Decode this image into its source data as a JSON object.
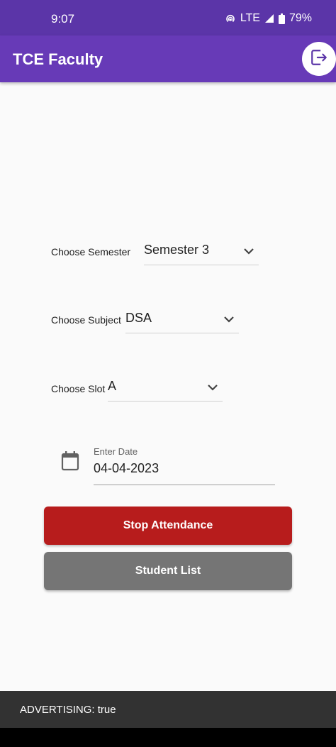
{
  "status_bar": {
    "time": "9:07",
    "network": "LTE",
    "battery": "79%"
  },
  "app_bar": {
    "title": "TCE Faculty",
    "logout_icon": "logout-icon",
    "accent": "#673ab7"
  },
  "form": {
    "semester": {
      "label": "Choose Semester",
      "value": "Semester 3"
    },
    "subject": {
      "label": "Choose Subject",
      "value": "DSA"
    },
    "slot": {
      "label": "Choose Slot",
      "value": "A"
    },
    "date": {
      "label": "Enter Date",
      "value": "04-04-2023",
      "icon": "calendar-icon"
    }
  },
  "buttons": {
    "stop_attendance": "Stop Attendance",
    "student_list": "Student List"
  },
  "snackbar": {
    "text": "ADVERTISING: true"
  }
}
